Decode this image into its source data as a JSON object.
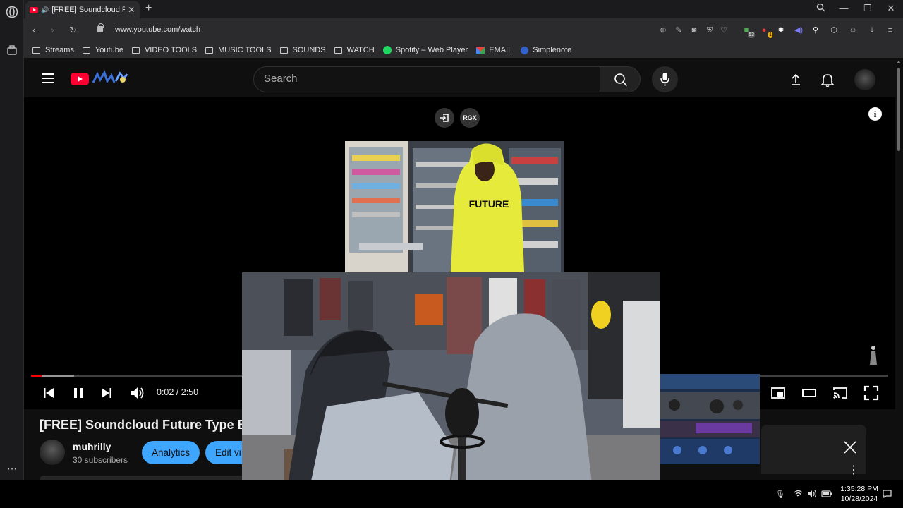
{
  "browser": {
    "tab_title": "[FREE] Soundcloud Futu",
    "new_tab": "+",
    "url": "www.youtube.com/watch",
    "extension_badges": [
      "53",
      "1"
    ],
    "bookmarks": [
      {
        "label": "Streams",
        "icon": "folder-icon"
      },
      {
        "label": "Youtube",
        "icon": "folder-icon"
      },
      {
        "label": "VIDEO TOOLS",
        "icon": "folder-icon"
      },
      {
        "label": "MUSIC TOOLS",
        "icon": "folder-icon"
      },
      {
        "label": "SOUNDS",
        "icon": "folder-icon"
      },
      {
        "label": "WATCH",
        "icon": "folder-icon"
      },
      {
        "label": "Spotify – Web Player",
        "icon": "spotify-icon"
      },
      {
        "label": "EMAIL",
        "icon": "gmail-icon"
      },
      {
        "label": "Simplenote",
        "icon": "simplenote-icon"
      }
    ]
  },
  "youtube": {
    "search_placeholder": "Search",
    "player": {
      "rgx_label": "RGX",
      "time": "0:02 / 2:50",
      "progress_played_fraction": 0.012,
      "progress_buffered_fraction": 0.05,
      "video_text": "FUTURE"
    },
    "video_title": "[FREE] Soundcloud Future Type Bea",
    "channel": {
      "name": "muhrilly",
      "subscribers": "30 subscribers"
    },
    "buttons": {
      "analytics": "Analytics",
      "edit_video": "Edit vi"
    }
  },
  "taskbar": {
    "time": "1:35:28 PM",
    "date": "10/28/2024"
  },
  "colors": {
    "yt_red": "#ff0033",
    "accent_blue": "#3ea6ff",
    "progress_red": "#ff0000",
    "page_bg": "#0f0f0f"
  }
}
